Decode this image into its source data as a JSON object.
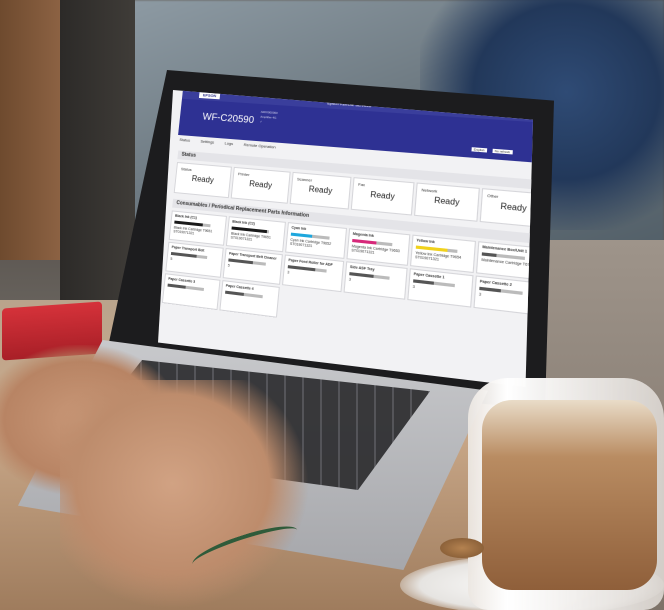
{
  "app": {
    "brand": "EPSON",
    "title": "Epson Remote Services",
    "model": "WF-C20590",
    "info_lines": [
      "A00X000000",
      "Amplifier 4G",
      "✓"
    ]
  },
  "header_controls": {
    "lang": "English",
    "refresh": "No refresh"
  },
  "toolbar": {
    "status": "Status",
    "settings": "Settings",
    "logs": "Logs",
    "remote": "Remote Operation"
  },
  "status": {
    "section": "Status",
    "cards": [
      {
        "label": "Status",
        "value": "Ready"
      },
      {
        "label": "Printer",
        "value": "Ready"
      },
      {
        "label": "Scanner",
        "value": "Ready"
      },
      {
        "label": "Fax",
        "value": "Ready"
      },
      {
        "label": "Network",
        "value": "Ready"
      },
      {
        "label": "Other",
        "value": "Ready"
      }
    ]
  },
  "consumables": {
    "section": "Consumables / Periodical Replacement Parts Information",
    "items": [
      {
        "name": "Black Ink (C1)",
        "color": "#1a1a1a",
        "level": 0.8,
        "line1": "Black Ink Cartridge T9651",
        "line2": "ST019071321"
      },
      {
        "name": "Black Ink (C2)",
        "color": "#1a1a1a",
        "level": 0.95,
        "line1": "Black Ink Cartridge T9651",
        "line2": "ST019071321"
      },
      {
        "name": "Cyan Ink",
        "color": "#1ea7dd",
        "level": 0.55,
        "line1": "Cyan Ink Cartridge T9652",
        "line2": "ST019071321"
      },
      {
        "name": "Magenta Ink",
        "color": "#d6287a",
        "level": 0.6,
        "line1": "Magenta Ink Cartridge T9653",
        "line2": "ST019071321"
      },
      {
        "name": "Yellow Ink",
        "color": "#f1d21c",
        "level": 0.75,
        "line1": "Yellow Ink Cartridge T9654",
        "line2": "ST019071321"
      },
      {
        "name": "Maintenance Box/Unit 1",
        "color": "#555555",
        "level": 0.35,
        "line1": "Maintenance Cartridge T6714",
        "line2": ""
      },
      {
        "name": "Paper Transport Belt",
        "color": "#555555",
        "level": 0.7,
        "line1": "5",
        "line2": ""
      },
      {
        "name": "Paper Transport Belt Cleaner",
        "color": "#555555",
        "level": 0.65,
        "line1": "5",
        "line2": ""
      },
      {
        "name": "Paper Feed Roller for ADF",
        "color": "#555555",
        "level": 0.7,
        "line1": "3",
        "line2": ""
      },
      {
        "name": "Side ASF Tray",
        "color": "#555555",
        "level": 0.6,
        "line1": "3",
        "line2": ""
      },
      {
        "name": "Paper Cassette 1",
        "color": "#555555",
        "level": 0.5,
        "line1": "3",
        "line2": ""
      },
      {
        "name": "Paper Cassette 2",
        "color": "#555555",
        "level": 0.5,
        "line1": "3",
        "line2": ""
      },
      {
        "name": "Paper Cassette 3",
        "color": "#555555",
        "level": 0.5,
        "line1": "",
        "line2": ""
      },
      {
        "name": "Paper Cassette 4",
        "color": "#555555",
        "level": 0.5,
        "line1": "",
        "line2": ""
      }
    ]
  }
}
